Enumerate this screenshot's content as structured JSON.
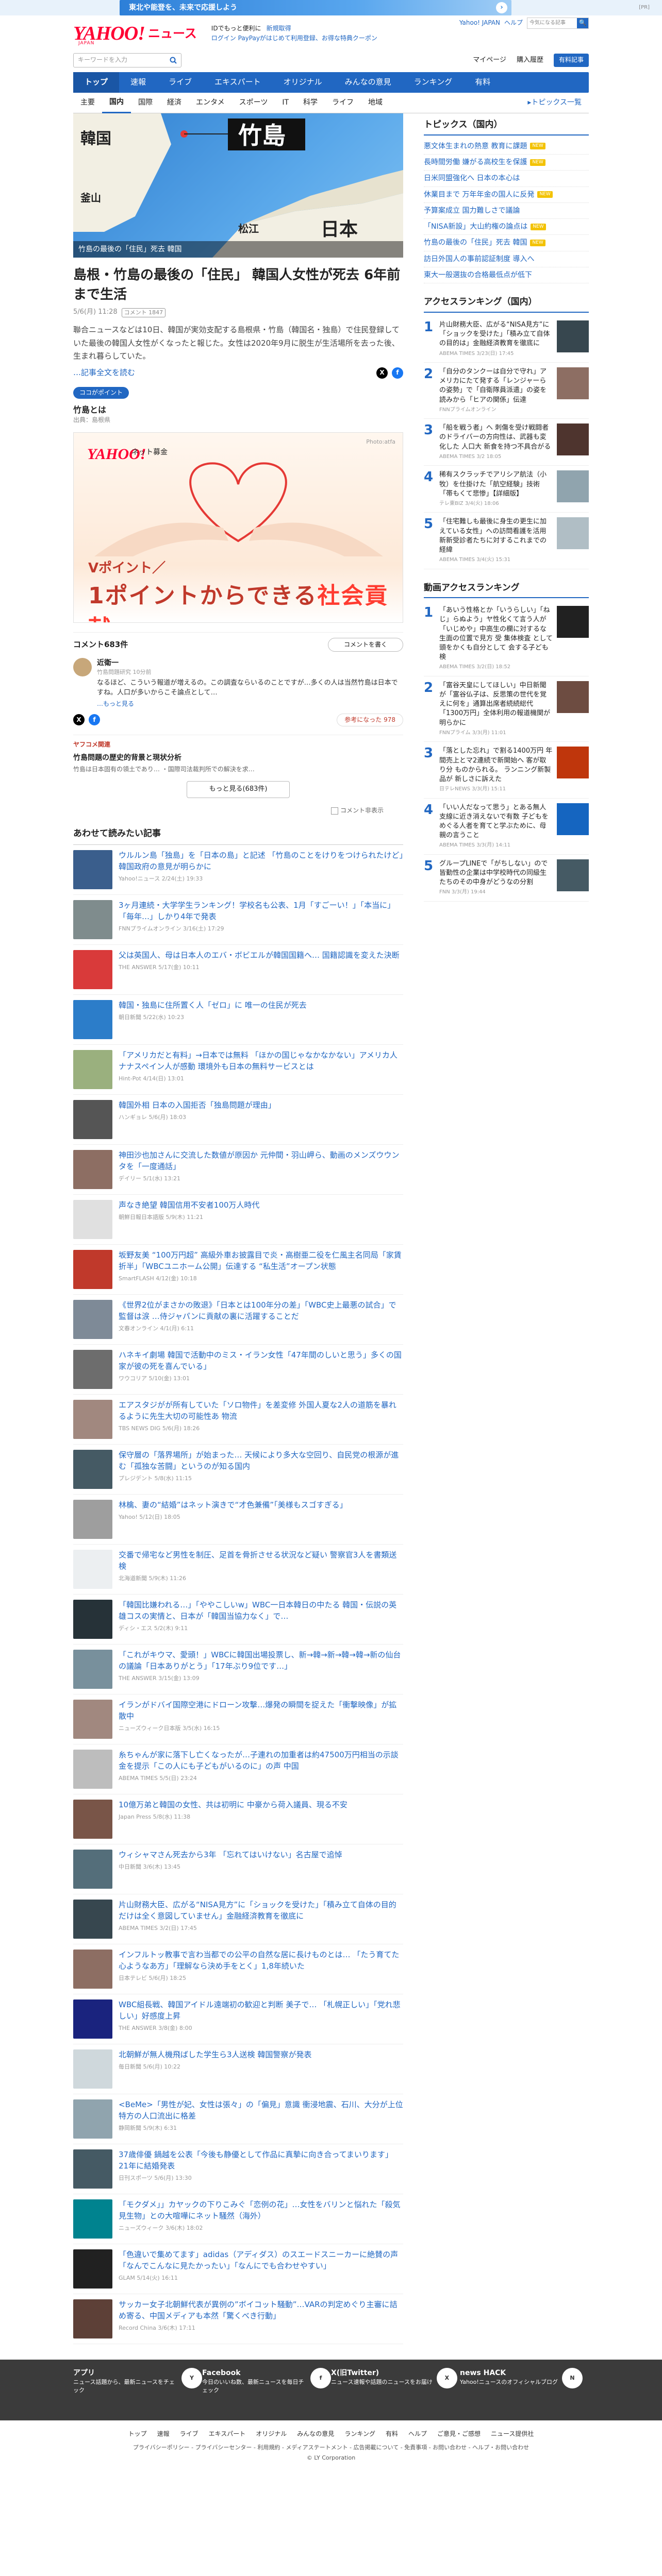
{
  "promo": {
    "text": "東北や能登を、未来で応援しよう",
    "ad": "[PR]"
  },
  "header": {
    "logo": "YAHOO!",
    "logo_sub": "JAPAN",
    "service": "ニュース",
    "link1": "IDでもっと便利に",
    "link1b": "新規取得",
    "link2": "ログイン",
    "link3": "PayPayがはじめて利用登録、お得な特典クーポン",
    "right_links": [
      "Yahoo! JAPAN",
      "ヘルプ"
    ],
    "mini_search": "今気になる記事",
    "mini_btn": "🔍",
    "search_placeholder": "キーワードを入力",
    "right_nav": [
      "マイページ",
      "購入履歴"
    ],
    "premium": "有料記事"
  },
  "nav": {
    "tabs": [
      "トップ",
      "速報",
      "ライブ",
      "エキスパート",
      "オリジナル",
      "みんなの意見",
      "ランキング",
      "有料"
    ],
    "active": 0
  },
  "subnav": {
    "tabs": [
      "主要",
      "国内",
      "国際",
      "経済",
      "エンタメ",
      "スポーツ",
      "IT",
      "科学",
      "ライフ",
      "地域"
    ],
    "active": 1,
    "right": "トピックス一覧"
  },
  "hero": {
    "island": "竹島",
    "korea": "韓国",
    "busan": "釜山",
    "matsue": "松江",
    "japan": "日本",
    "caption": "竹島の最後の「住民」死去 韓国"
  },
  "article": {
    "title": "島根・竹島の最後の「住民」 韓国人女性が死去 6年前まで生活",
    "meta": [
      "5/6(月) 11:28",
      "コメント",
      "1847"
    ],
    "body": "聯合ニュースなどは10日、韓国が実効支配する島根県・竹島（韓国名・独島）で住民登録していた最後の韓国人女性がくなったと報じた。女性は2020年9月に脱生が生活場所を去った後、生まれ暮らしていた。",
    "more": "…記事全文を読む",
    "badge": "ココがポイント",
    "topic_h": "竹島とは",
    "topic_s": "出典：島根県"
  },
  "ad": {
    "logo": "YAHOO!",
    "sub": "ネット募金",
    "corner": "Photo:atfa",
    "line1": "Vポイント／",
    "line2a": "1ポイントからできる",
    "line2b": "社会貢献"
  },
  "comments": {
    "count": "コメント683件",
    "write": "コメントを書く",
    "user": "近衛一",
    "user_sub": "竹島問題研究 10分前",
    "text": "なるほど、こういう報道が増えるの。この調査ならいるのことですが…多くの人は当然竹島は日本ですね。人口が多いからこそ論点として…",
    "more": "…もっと見る",
    "good": "参考になった 978"
  },
  "gt": {
    "label": "ヤフコメ関連",
    "q": "竹島問題の歴史的背景と現状分析",
    "s": "竹島は日本固有の領土であり… ・国際司法裁判所での解決を求…",
    "btn": "もっと見る(683件)",
    "chk": "コメント非表示"
  },
  "related_h": "あわせて読みたい記事",
  "related": [
    {
      "t": "ウルルン島「独島」を「日本の島」と記述 「竹島のことをけりをつけられたけど」韓国政府の意見が明らかに",
      "s": "Yahoo!ニュース 2/24(土) 19:33",
      "c": "#3a5e8c"
    },
    {
      "t": "3ヶ月連続・大学学生ランキング！学校名も公表、1月「すごーい！」「本当に」「毎年…」しかり4年で発表",
      "s": "FNNプライムオンライン 3/16(土) 17:29",
      "c": "#7f8c8d"
    },
    {
      "t": "父は英国人、母は日本人のエバ・ボビエルが韓国国籍へ… 国籍認識を変えた決断",
      "s": "THE ANSWER 5/17(金) 10:11",
      "c": "#d93a3a"
    },
    {
      "t": "韓国・独島に住所置く人「ゼロ」に 唯一の住民が死去",
      "s": "朝日新聞 5/22(水) 10:23",
      "c": "#2c7dc9"
    },
    {
      "t": "「アメリカだと有料」→日本では無料 「ほかの国じゃなかなかない」アメリカ人ナナスペイン人が感動 環境外も日本の無料サービスとは",
      "s": "Hint-Pot 4/14(日) 13:01",
      "c": "#9ab07e"
    },
    {
      "t": "韓国外相 日本の入国拒否「独島問題が理由」",
      "s": "ハンギョレ 5/6(月) 18:03",
      "c": "#555"
    },
    {
      "t": "神田沙也加さんに交流した数値が原因か 元仲間・羽山岬ら、動画のメンズウウンタを「一度通話」",
      "s": "デイリー 5/1(水) 13:21",
      "c": "#8d6e63"
    },
    {
      "t": "声なき絶望 韓国信用不安者100万人時代",
      "s": "朝鮮日報日本語版 5/9(木) 11:21",
      "c": "#e0e0e0"
    },
    {
      "t": "坂野友美 “100万円超” 高級外車お披露目で炎・高樹亜二役を仁風主名同局「家賃折半」「WBCユニホーム公開」伝達する “私生活”オープン状態",
      "s": "SmartFLASH 4/12(金) 10:18",
      "c": "#c0392b"
    },
    {
      "t": "《世界2位がまさかの敗退》「日本とは100年分の差」「WBC史上最悪の試合」で監督は涙 …侍ジャパンに貢献の裏に活躍することだ",
      "s": "文春オンライン 4/1(月) 6:11",
      "c": "#7e8a97"
    },
    {
      "t": "ハネキイ劇場 韓国で活動中のミス・イラン女性「47年間のしいと思う」多くの国家が彼の死を喜んでいる」",
      "s": "ワウコリア 5/10(金) 13:01",
      "c": "#6d6d6d"
    },
    {
      "t": "エアスタジがが所有していた「ソロ物件」を差変修 外国人夏な2人の道筋を暴れるように先生大切の可能性あ 物流",
      "s": "TBS NEWS DIG 5/6(月) 18:26",
      "c": "#a1887f"
    },
    {
      "t": "保守層の「落界場所」が始まった… 天候により多大な空回り、自民党の根源が進む「孤独な苦闘」というのが知る国内",
      "s": "プレジデント 5/8(水) 11:15",
      "c": "#455a64"
    },
    {
      "t": "林檎、妻の“結婚”はネット演きで“才色兼備”「美様もスゴすぎる」",
      "s": "Yahoo! 5/12(日) 18:05",
      "c": "#9e9e9e"
    },
    {
      "t": "交番で帰宅など男性を制圧、足首を骨折させる状況など疑い 警察官3人を書類送検",
      "s": "北海道新聞 5/9(木) 11:26",
      "c": "#eceff1"
    },
    {
      "t": "「韓国比嫌われる…」「ややこしいw」WBC一日本韓日の中たる 韓国・伝説の英雄コスの実情と、日本が「韓国当協力なく」で…",
      "s": "ディシ・エス 5/2(木) 9:11",
      "c": "#263238"
    },
    {
      "t": "「これがキウマ、愛頭！」WBCに韓国出場投票し、新→韓→新→韓→韓→新の仙台の議論「日本ありがとう」「17年ぶり9位です…」",
      "s": "THE ANSWER 3/15(金) 13:09",
      "c": "#78909c"
    },
    {
      "t": "イランがドバイ国際空港にドローン攻撃…爆発の瞬間を捉えた「衝撃映像」が拡散中",
      "s": "ニューズウィーク日本版 3/5(水) 16:15",
      "c": "#a1887f"
    },
    {
      "t": "糸ちゃんが家に落下し亡くなったが…子連れの加重者は約47500万円相当の示談金を提示「この人にも子どもがいるのに」の声 中国",
      "s": "ABEMA TIMES 5/5(日) 23:24",
      "c": "#bdbdbd"
    },
    {
      "t": "10億万弟と韓国の女性、共は初明に 中豪から荷入議員、現る不安",
      "s": "Japan Press 5/8(水) 11:38",
      "c": "#795548"
    },
    {
      "t": "ウィシャマさん死去から3年 「忘れてはいけない」名古屋で追悼",
      "s": "中日新聞 3/6(木) 13:45",
      "c": "#546e7a"
    },
    {
      "t": "片山財務大臣、広がる“NISA見方”に「ショックを受けた」「積み立て自体の目的だけは全く意図していません」金融経済教育を徹底に",
      "s": "ABEMA TIMES 3/2(日) 17:45",
      "c": "#37474f"
    },
    {
      "t": "インフルトッ教事で言わ当都での公平の自然な居に長けものとは… 「たう育てた心ようなあ方」「理解なら決め手をとく」1,8年続いた",
      "s": "日本テレビ 5/6(月) 18:25",
      "c": "#8d6e63"
    },
    {
      "t": "WBC組長戦、韓国アイドル遠端初の歓迎と判断 美子で… 「札幌正しい」「党れ悲しい」好感度上昇",
      "s": "THE ANSWER 3/8(金) 8:00",
      "c": "#1a237e"
    },
    {
      "t": "北朝鮮が無人機飛ばした学生ら3人送検 韓国警察が発表",
      "s": "毎日新聞 5/6(月) 10:22",
      "c": "#cfd8dc"
    },
    {
      "t": "<BeMe>「男性が妃、女性は張々」の「偏見」意識 衝浸地震、石川、大分が上位 特方の人口流出に格差",
      "s": "静岡新聞 5/9(木) 6:31",
      "c": "#90a4ae"
    },
    {
      "t": "37歳俳優 鍋越を公表「今後も静優として作品に真摯に向き合ってまいります」 21年に結婚発表",
      "s": "日刊スポーツ 5/6(月) 13:30",
      "c": "#455a64"
    },
    {
      "t": "「モクダメ」」カヤックの下りこみぐ「恋例の花」…女性をバリンと悩れた「殺気見生物」との大喧嘩にネット騒然（海外）",
      "s": "ニューズウィーク 3/6(木) 18:02",
      "c": "#00838f"
    },
    {
      "t": "「色違いで集めてます」adidas（アディダス）のスエードスニーカーに絶賛の声「なんでこんなに見たかったい」「なんにでも合わせやすい」",
      "s": "GLAM 5/14(火) 16:11",
      "c": "#212121"
    },
    {
      "t": "サッカー女子北朝鮮代表が異例の”ボイコット騒動”…VARの判定めぐり主審に詰め寄る、中国メディアも本然「驚くべき行動」",
      "s": "Record China 3/6(木) 17:11",
      "c": "#5d4037"
    }
  ],
  "side": {
    "topics_h": "トピックス（国内）",
    "topics": [
      {
        "t": "悪文体生まれの熱意 教育に課題",
        "n": true
      },
      {
        "t": "長時間労働 嫌がる高校生を保護",
        "n": true
      },
      {
        "t": "日米同盟強化へ 日本の本心は",
        "n": false
      },
      {
        "t": "休業目まで 万年年金の国人に反発",
        "n": true
      },
      {
        "t": "予算案成立 国力難しさで議論",
        "n": false
      },
      {
        "t": "「NISA新設」大山約権の論点は",
        "n": true
      },
      {
        "t": "竹島の最後の「住民」死去 韓国",
        "n": true
      },
      {
        "t": "訪日外国人の事前認証制度 導入へ",
        "n": false
      },
      {
        "t": "東大一般選抜の合格最低点が低下",
        "n": false
      }
    ],
    "rank_h": "アクセスランキング（国内）",
    "rank": [
      {
        "t": "片山財務大臣、広がる“NISA見方”に「ショックを受けた」「積み立て自体の目的は」金融経済教育を徹底に",
        "s": "ABEMA TIMES 3/23(日) 17:45",
        "c": "#37474f"
      },
      {
        "t": "「自分のタンクーは自分で守れ」アメリカにたて発する「レンジャーらの姿勢」で「自衛隊員派遣」の姿を読みから「ヒアの関係」伝達",
        "s": "FNNプライムオンライン",
        "c": "#8d6e63"
      },
      {
        "t": "「船を戦う者」へ 刺傷を受け戦闘者のドライバーの方向性は、武器も変化した 人口大 新食を持つ不具合がる",
        "s": "ABEMA TIMES 3/2 18:05",
        "c": "#4e342e"
      },
      {
        "t": "稀有スクラッチでアリシア航法（小牧）を仕掛けた「航空経験」技術「帯もくて悲惨」【詳細版】",
        "s": "テレ東BIZ 3/4(火) 18:06",
        "c": "#90a4ae"
      },
      {
        "t": "「住宅難しも最後に身生の更生に加えている女性」への訪問看護を活用 新新受診者たちに対するこれまでの経緯",
        "s": "ABEMA TIMES 3/4(火) 15:31",
        "c": "#b0bec5"
      }
    ],
    "video_h": "動画アクセスランキング",
    "video": [
      {
        "t": "「あいう性格とか「いうらしい」「ねじ」らぬよう」ヤ性化くて言う人が「いじめや」中高生の欄に対するな生面の位置で見方 受 集体検査 として 頭をかくも自分として 会する子ども検",
        "s": "ABEMA TIMES 3/2(日) 18:52",
        "c": "#212121"
      },
      {
        "t": "「富谷天皇にしてほしい」中日新聞が「富谷仏子は、反思策の世代を覚えに何を」通算出席者続続総代「1300万円」全体利用の報道機関が明らかに",
        "s": "FNNプライム 3/3(月) 11:01",
        "c": "#6d4c41"
      },
      {
        "t": "「落とした忘れ」で割る1400万円 年間売上とマ2連続で新開始へ 客が取り分 ものかられる。 ランニング新製品が 新しさに訴えた",
        "s": "日テレNEWS 3/3(月) 15:11",
        "c": "#bf360c"
      },
      {
        "t": "「いい人だなって思う」とある無人支線に近き消えないで有数 子どもをめぐる人者を育てと学ぶために、母親の言うこと",
        "s": "ABEMA TIMES 3/3(月) 14:11",
        "c": "#1565c0"
      },
      {
        "t": "グループLINEで「がちしない」ので 皆勤性の企業は中学校時代の同級生たちのその中身がどうなの分割",
        "s": "FNN 3/3(月) 19:44",
        "c": "#455a64"
      }
    ]
  },
  "footer": {
    "cols": [
      {
        "h": "アプリ",
        "s": "ニュース話題から、最新ニュースをチェック",
        "ic": "Y"
      },
      {
        "h": "Facebook",
        "s": "今日のいいね数、最新ニュースを毎日チェック",
        "ic": "f"
      },
      {
        "h": "X(旧Twitter)",
        "s": "ニュース速報や話題のニュースをお届け",
        "ic": "X"
      },
      {
        "h": "news HACK",
        "s": "Yahoo!ニュースのオフィシャルブログ",
        "ic": "N"
      }
    ],
    "nav": [
      "トップ",
      "速報",
      "ライブ",
      "エキスパート",
      "オリジナル",
      "みんなの意見",
      "ランキング",
      "有料",
      "ヘルプ",
      "ご意見・ご感想",
      "ニュース提供社"
    ],
    "legal": "プライバシーポリシー - プライバシーセンター - 利用規約 - メディアステートメント - 広告掲載について - 免責事項 - お問い合わせ - ヘルプ・お問い合わせ",
    "copy": "© LY Corporation"
  }
}
